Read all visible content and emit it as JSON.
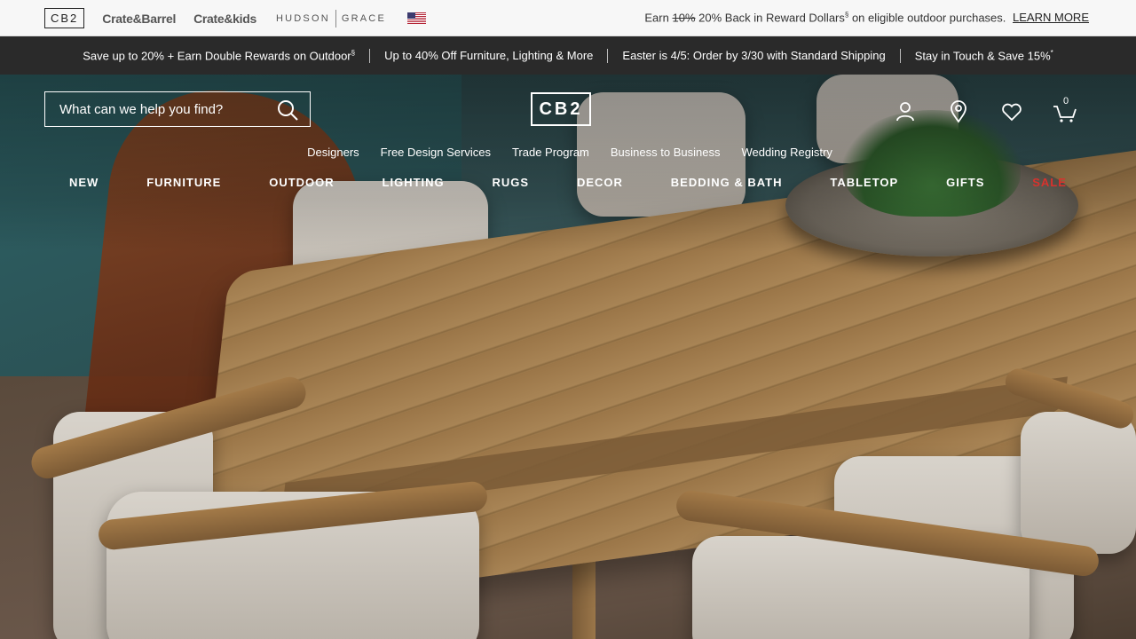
{
  "brand_bar": {
    "brands": {
      "cb2": "CB2",
      "crate_and_barrel": "Crate&Barrel",
      "crate_and_kids": "Crate&kids",
      "hudson": "HUDSON",
      "grace": "GRACE"
    },
    "reward": {
      "prefix": "Earn",
      "old_rate": "10%",
      "text": "20% Back in Reward Dollars",
      "sup": "§",
      "suffix": "on eligible outdoor purchases.",
      "link": "LEARN MORE"
    }
  },
  "promo_bar": {
    "items": [
      {
        "text": "Save up to 20% + Earn Double Rewards on Outdoor",
        "sup": "§"
      },
      {
        "text": "Up to 40% Off Furniture, Lighting & More",
        "sup": ""
      },
      {
        "text": "Easter is 4/5: Order by 3/30 with Standard Shipping",
        "sup": ""
      },
      {
        "text": "Stay in Touch & Save 15%",
        "sup": "*"
      }
    ]
  },
  "header": {
    "search": {
      "placeholder": "What can we help you find?",
      "value": ""
    },
    "logo": "CB2",
    "cart_count": "0",
    "icons": [
      "account-icon",
      "location-pin-icon",
      "heart-icon",
      "cart-icon",
      "search-icon"
    ]
  },
  "subnav": {
    "items": [
      "Designers",
      "Free Design Services",
      "Trade Program",
      "Business to Business",
      "Wedding Registry"
    ]
  },
  "mainnav": {
    "items": [
      "NEW",
      "FURNITURE",
      "OUTDOOR",
      "LIGHTING",
      "RUGS",
      "DECOR",
      "BEDDING & BATH",
      "TABLETOP",
      "GIFTS",
      "SALE"
    ]
  },
  "colors": {
    "sale": "#d8322d",
    "promo_bg": "#2a2a2a",
    "brandbar_bg": "#f7f7f7"
  }
}
